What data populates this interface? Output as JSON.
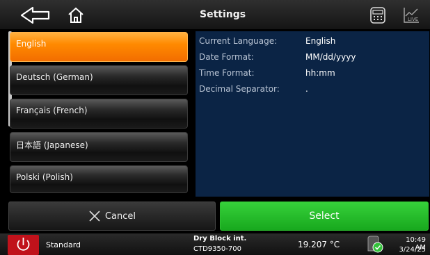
{
  "header": {
    "title": "Settings",
    "back_icon": "back-arrow-icon",
    "home_icon": "home-icon",
    "calculator_icon": "calculator-icon",
    "live_icon": "live-chart-icon",
    "live_label": "LIVE"
  },
  "languages": [
    {
      "label": "English",
      "selected": true
    },
    {
      "label": "Deutsch (German)",
      "selected": false
    },
    {
      "label": "Français (French)",
      "selected": false
    },
    {
      "label": "日本語 (Japanese)",
      "selected": false
    },
    {
      "label": "Polski (Polish)",
      "selected": false
    }
  ],
  "info": {
    "rows": [
      {
        "label": "Current Language:",
        "value": "English"
      },
      {
        "label": "Date Format:",
        "value": "MM/dd/yyyy"
      },
      {
        "label": "Time Format:",
        "value": "hh:mm"
      },
      {
        "label": "Decimal Separator:",
        "value": "."
      }
    ]
  },
  "actions": {
    "cancel_label": "Cancel",
    "select_label": "Select"
  },
  "status": {
    "mode": "Standard",
    "device_name": "Dry Block int.",
    "device_model": "CTD9350-700",
    "temperature": "19.207 °C",
    "time": "10:49 AM",
    "date": "3/24/25"
  },
  "colors": {
    "selected_item": "#ff8a00",
    "select_button": "#22bf28",
    "info_panel": "#0b2445",
    "power_button": "#c0121b"
  }
}
